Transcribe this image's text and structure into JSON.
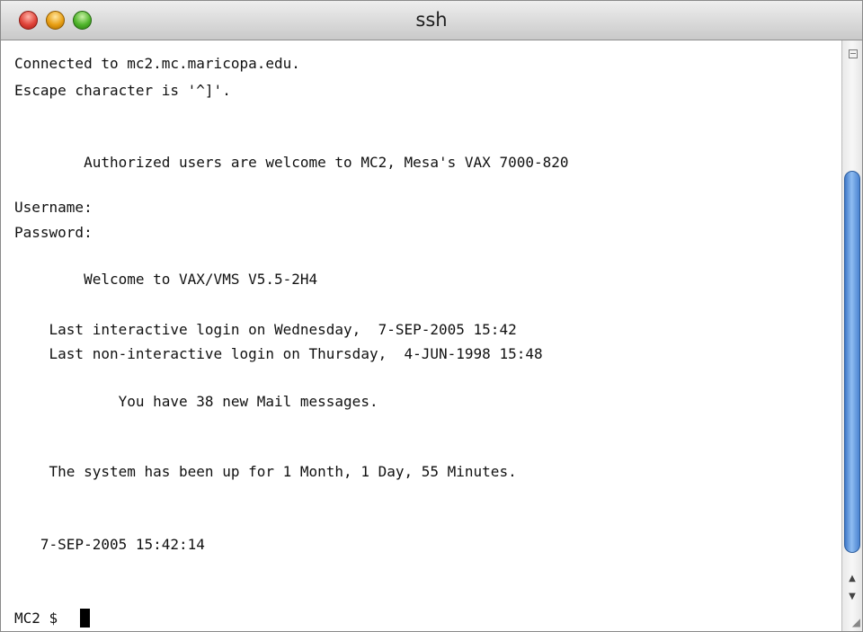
{
  "window": {
    "title": "ssh"
  },
  "terminal": {
    "lines": [
      "Connected to mc2.mc.maricopa.edu.",
      "Escape character is '^]'.",
      "        Authorized users are welcome to MC2, Mesa's VAX 7000-820",
      "Username:",
      "Password:",
      "        Welcome to VAX/VMS V5.5-2H4",
      "    Last interactive login on Wednesday,  7-SEP-2005 15:42",
      "    Last non-interactive login on Thursday,  4-JUN-1998 15:48",
      "            You have 38 new Mail messages.",
      "    The system has been up for 1 Month, 1 Day, 55 Minutes.",
      "   7-SEP-2005 15:42:14",
      "MC2 $ "
    ]
  },
  "icons": {
    "close": "close-icon",
    "minimize": "minimize-icon",
    "zoom": "zoom-icon",
    "split": "split-pane-icon",
    "scroll_up": "scroll-up-arrow-icon",
    "scroll_down": "scroll-down-arrow-icon",
    "resize": "resize-grip-icon"
  },
  "colors": {
    "close": "#e0443a",
    "minimize": "#e89f14",
    "zoom": "#4fb52b",
    "scroll_thumb": "#5b93dc"
  }
}
